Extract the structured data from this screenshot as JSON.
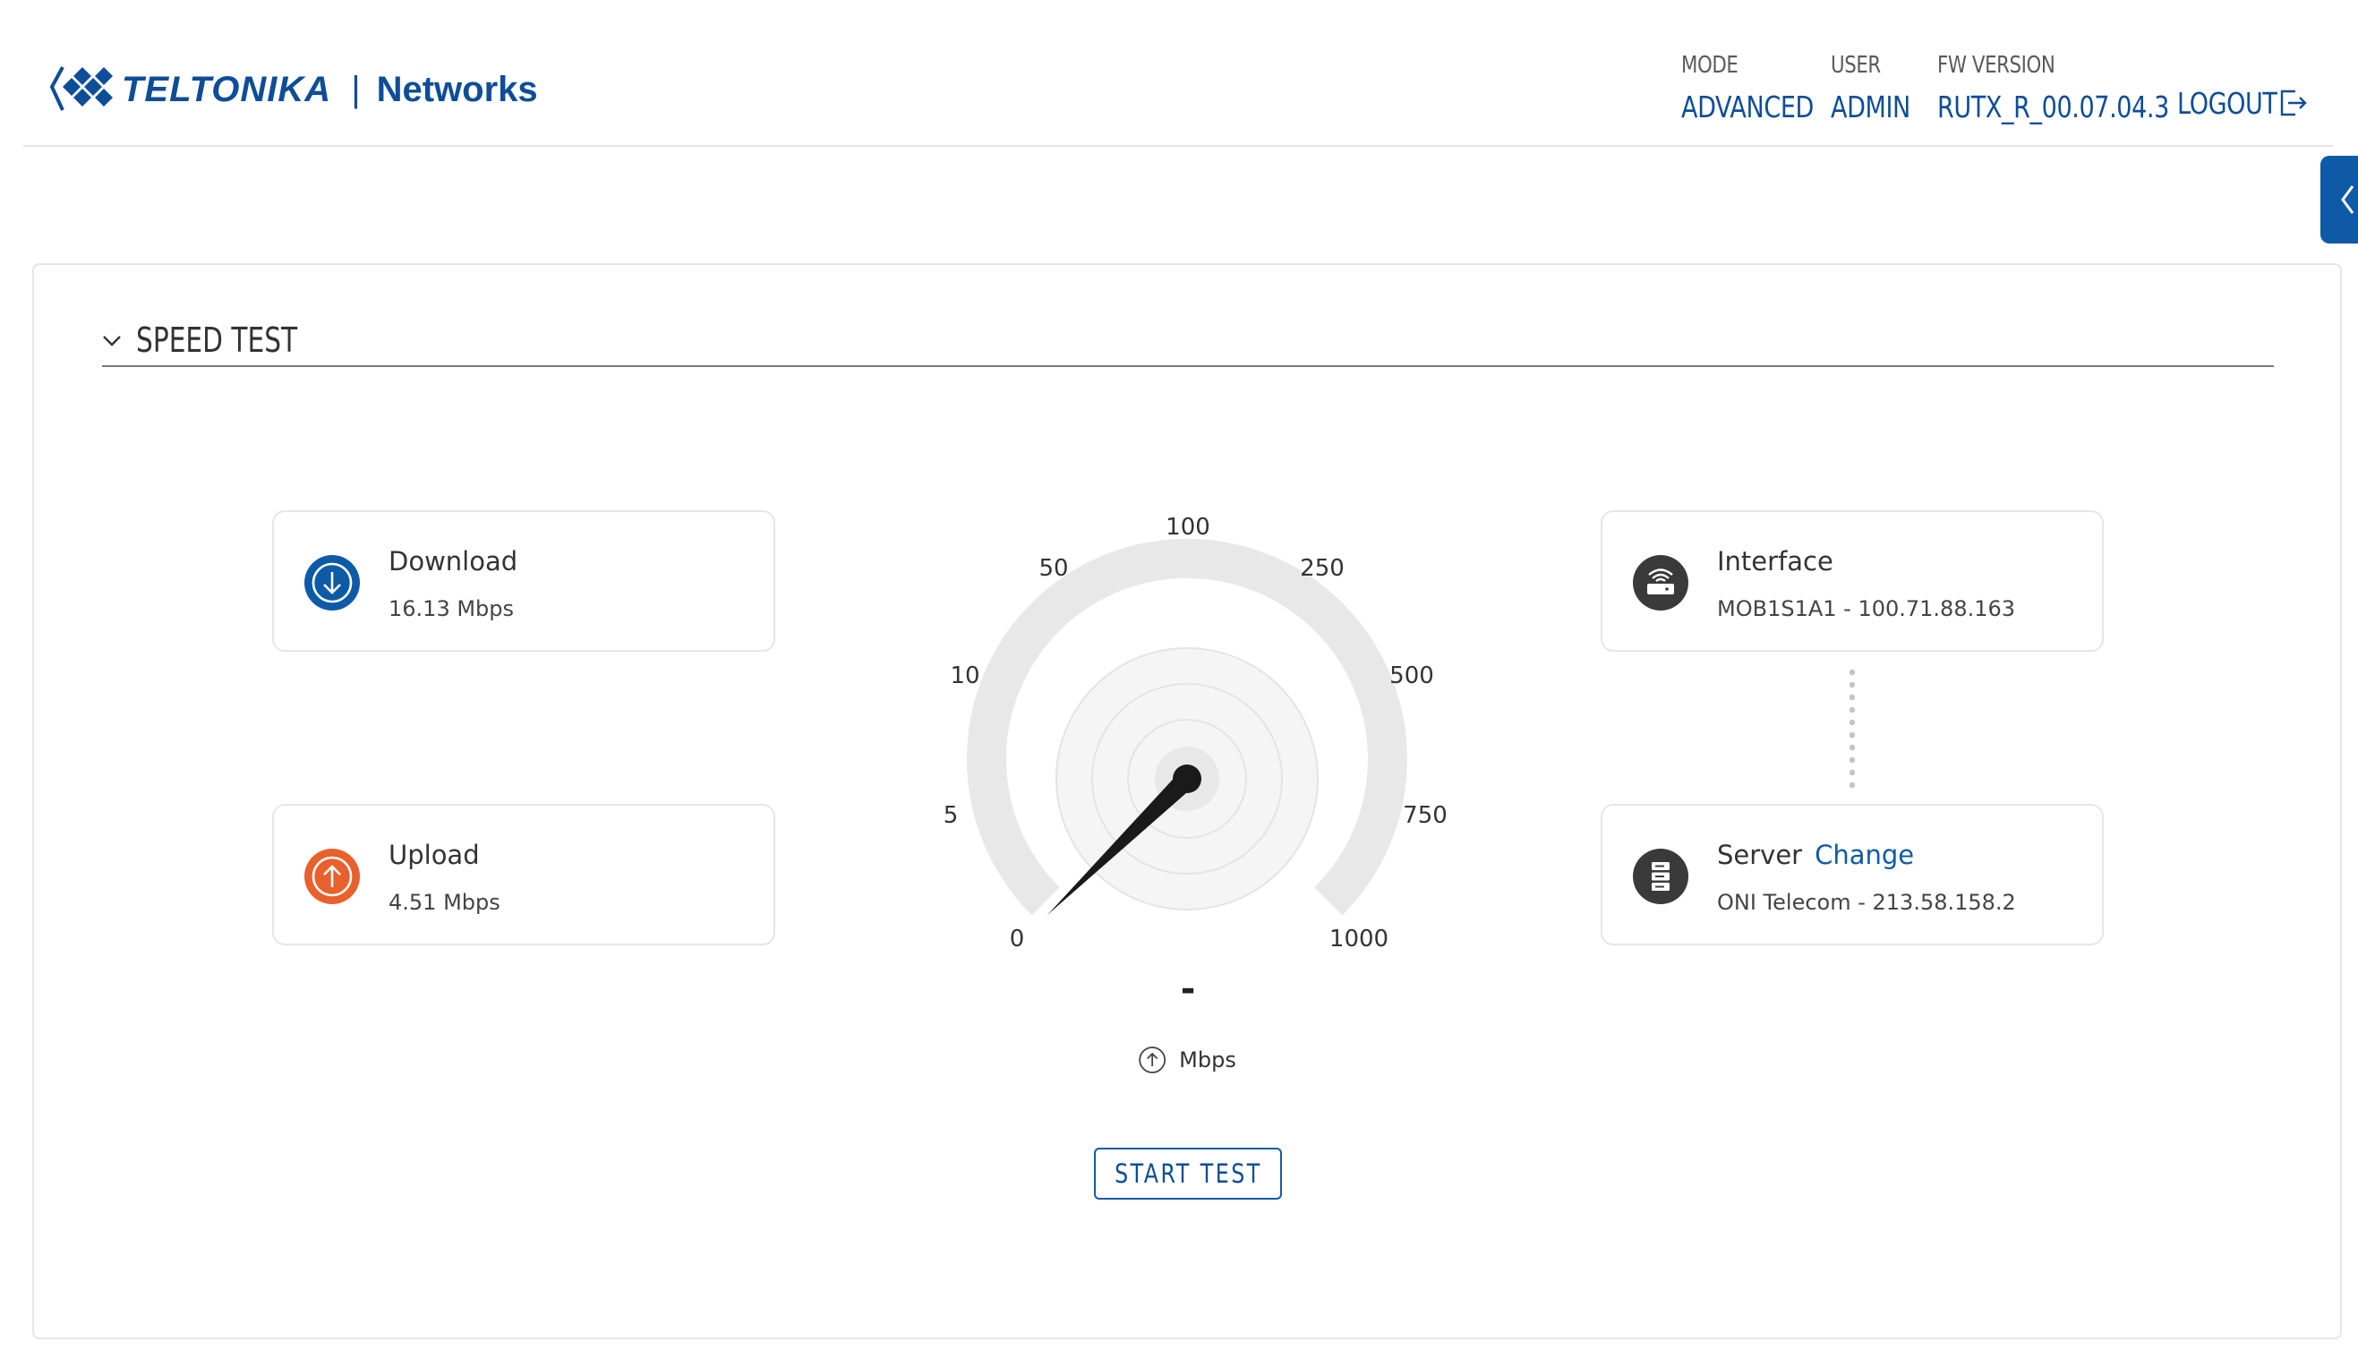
{
  "brand": {
    "name": "TELTONIKA",
    "separator": "|",
    "sub": "Networks",
    "color": "#0e4d97"
  },
  "header": {
    "mode_label": "MODE",
    "mode_value": "ADVANCED",
    "user_label": "USER",
    "user_value": "ADMIN",
    "fw_label": "FW VERSION",
    "fw_value": "RUTX_R_00.07.04.3",
    "logout": "LOGOUT"
  },
  "section": {
    "title": "SPEED TEST"
  },
  "cards": {
    "download": {
      "title": "Download",
      "value": "16.13 Mbps",
      "icon": "download-arrow-icon",
      "color": "#0e5aa7"
    },
    "upload": {
      "title": "Upload",
      "value": "4.51 Mbps",
      "icon": "upload-arrow-icon",
      "color": "#e8602c"
    },
    "interface": {
      "title": "Interface",
      "value": "MOB1S1A1 - 100.71.88.163",
      "icon": "router-icon"
    },
    "server": {
      "title": "Server",
      "change": "Change",
      "value": "ONI Telecom - 213.58.158.2",
      "icon": "server-icon"
    }
  },
  "gauge": {
    "ticks": [
      "0",
      "5",
      "10",
      "50",
      "100",
      "250",
      "500",
      "750",
      "1000"
    ],
    "current": "-",
    "unit": "Mbps",
    "unit_icon": "upload-arrow-icon"
  },
  "actions": {
    "start": "START TEST"
  }
}
